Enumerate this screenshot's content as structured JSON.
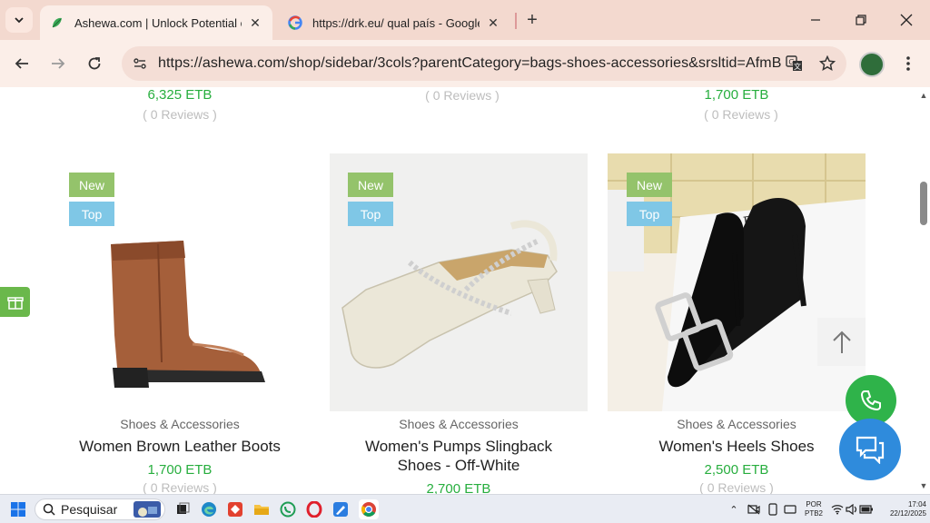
{
  "browser": {
    "tabs": [
      {
        "title": "Ashewa.com | Unlock Potential of C",
        "active": true
      },
      {
        "title": "https://drk.eu/ qual país - Google",
        "active": false
      }
    ],
    "url": "https://ashewa.com/shop/sidebar/3cols?parentCategory=bags-shoes-accessories&srsltid=AfmB...",
    "accent_color": "#f3d9cf"
  },
  "top_row": [
    {
      "price": "6,325 ETB",
      "reviews": "( 0 Reviews )"
    },
    {
      "price": "",
      "reviews": "( 0 Reviews )"
    },
    {
      "price": "1,700 ETB",
      "reviews": "( 0 Reviews )"
    }
  ],
  "products": [
    {
      "badges": [
        "New",
        "Top"
      ],
      "category": "Shoes & Accessories",
      "name_line1": "Women Brown Leather Boots",
      "name_line2": "",
      "price": "1,700 ETB",
      "reviews": "( 0 Reviews )",
      "image_icon": "brown-ankle-boot"
    },
    {
      "badges": [
        "New",
        "Top"
      ],
      "category": "Shoes & Accessories",
      "name_line1": "Women's Pumps Slingback",
      "name_line2": "Shoes - Off-White",
      "price": "2,700 ETB",
      "reviews": "",
      "image_icon": "off-white-slingback-pump"
    },
    {
      "badges": [
        "New",
        "Top"
      ],
      "category": "Shoes & Accessories",
      "name_line1": "Women's Heels Shoes",
      "name_line2": "",
      "price": "2,500 ETB",
      "reviews": "( 0 Reviews )",
      "image_icon": "black-heel-shoe"
    }
  ],
  "colors": {
    "price_green": "#27ae3e",
    "badge_new": "#94c36b",
    "badge_top": "#7fc7e6",
    "whatsapp_green": "#2fb34a",
    "chat_blue": "#2f8bdc"
  },
  "taskbar": {
    "search_placeholder": "Pesquisar",
    "lang_line1": "POR",
    "lang_line2": "PTB2",
    "time": "17:04",
    "date": "22/12/2025"
  }
}
